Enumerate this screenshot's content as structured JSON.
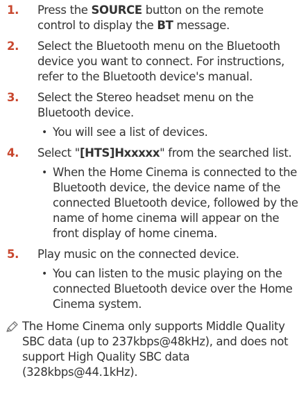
{
  "steps": [
    {
      "number": "1.",
      "text_a": "Press the ",
      "kw_1": "SOURCE",
      "text_b": " button on the remote control to display the ",
      "kw_2": "BT",
      "text_c": " message."
    },
    {
      "number": "2.",
      "text": "Select the Bluetooth menu on the Bluetooth device you want to connect. For instructions, refer to the Bluetooth device's manual."
    },
    {
      "number": "3.",
      "text": "Select the Stereo headset menu on the Bluetooth device.",
      "sub": "You will see a list of devices."
    },
    {
      "number": "4.",
      "text_a": "Select \"",
      "kw": "[HTS]Hxxxxx",
      "text_b": "\" from the searched list.",
      "sub": "When the Home Cinema is connected to the Bluetooth device, the device name of the connected Bluetooth device, followed by the name of home cinema will appear on the front display of home cinema."
    },
    {
      "number": "5.",
      "text": "Play music on the connected device.",
      "sub": "You can listen to the music playing on the connected Bluetooth device over the Home Cinema system."
    }
  ],
  "bullet": "•",
  "note": {
    "icon": "note-pencil-icon",
    "text": "The Home Cinema only supports Middle Quality SBC data (up to 237kbps@48kHz), and does not support High Quality SBC data (328kbps@44.1kHz)."
  },
  "colors": {
    "text": "#333333",
    "step_number": "#c8472e",
    "icon": "#777777"
  }
}
